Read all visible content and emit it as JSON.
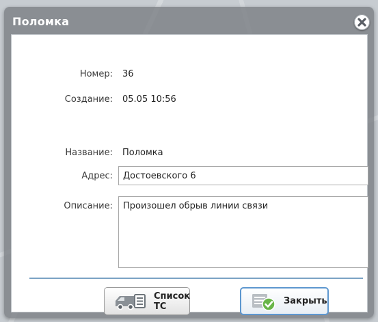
{
  "dialog": {
    "title": "Поломка",
    "close_icon": "close-icon"
  },
  "fields": {
    "number_label": "Номер:",
    "number_value": "36",
    "created_label": "Создание:",
    "created_value": "05.05 10:56",
    "name_label": "Название:",
    "name_value": "Поломка",
    "address_label": "Адрес:",
    "address_value": "Достоевского 6",
    "description_label": "Описание:",
    "description_value": "Произошел обрыв линии связи"
  },
  "buttons": {
    "vehicles_label": "Список ТС",
    "vehicles_icon": "truck-list-icon",
    "close_label": "Закрыть",
    "close_icon": "confirm-check-icon"
  },
  "colors": {
    "accent": "#5d97cf",
    "divider": "#7aa2c4",
    "check_green": "#69b548"
  }
}
